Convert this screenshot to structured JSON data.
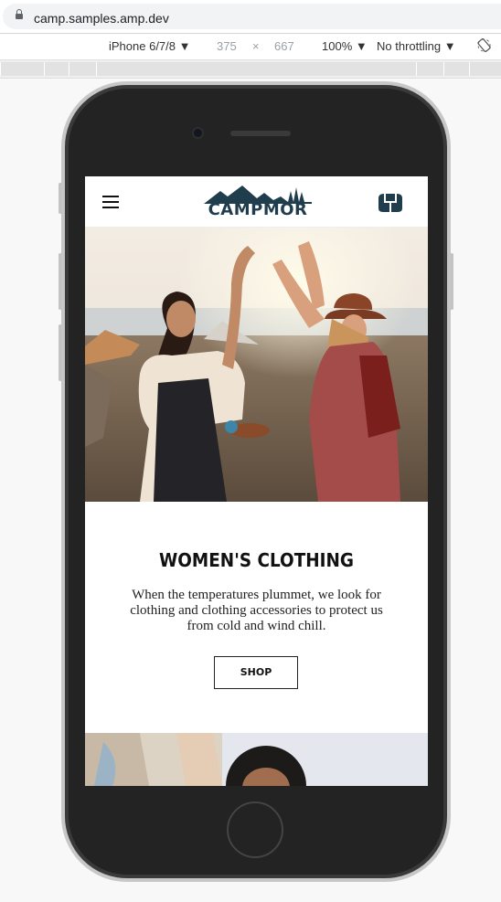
{
  "browser": {
    "url": "camp.samples.amp.dev",
    "device": "iPhone 6/7/8 ▼",
    "width": "375",
    "times": "×",
    "height": "667",
    "zoom": "100% ▼",
    "throttling": "No throttling ▼"
  },
  "site": {
    "logo_text": "CAMPMOR",
    "promo": {
      "title": "WOMEN'S CLOTHING",
      "description": "When the temperatures plummet, we look for clothing and clothing accessories to protect us from cold and wind chill.",
      "button_label": "SHOP"
    }
  },
  "colors": {
    "logo": "#1f3d4d",
    "phone_body": "#232323",
    "phone_rim": "#c7c7c7"
  }
}
